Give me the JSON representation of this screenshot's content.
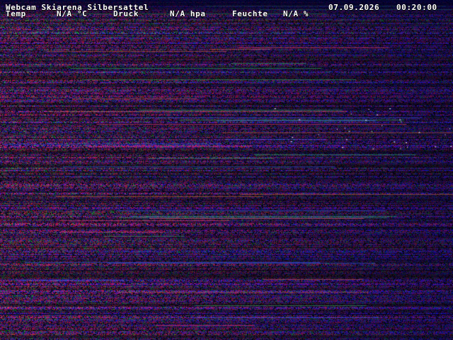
{
  "overlay": {
    "title": "Webcam Skiarena Silbersattel",
    "date": "07.09.2026",
    "time": "00:20:00",
    "temperature": {
      "label": "Temp",
      "value": "N/A °C"
    },
    "pressure": {
      "label": "Druck",
      "value": "N/A hpa"
    },
    "humidity": {
      "label": "Feuchte",
      "value": "N/A %"
    }
  },
  "image": {
    "content": "noise",
    "colors": [
      "#ff2a6a",
      "#2a3aff",
      "#25c46a",
      "#b43ad8",
      "#ff4a2a",
      "#ffffff"
    ]
  }
}
